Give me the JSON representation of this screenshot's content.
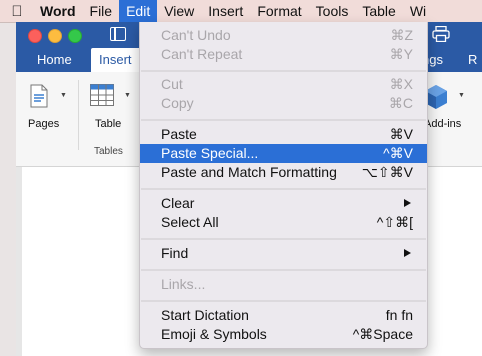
{
  "menubar": {
    "items": [
      {
        "label": "Word",
        "bold": true
      },
      {
        "label": "File"
      },
      {
        "label": "Edit",
        "active": true
      },
      {
        "label": "View"
      },
      {
        "label": "Insert"
      },
      {
        "label": "Format"
      },
      {
        "label": "Tools"
      },
      {
        "label": "Table"
      },
      {
        "label": "Wi"
      }
    ]
  },
  "window": {
    "tabs": {
      "home": "Home",
      "insert": "Insert",
      "ngs": "ngs",
      "r": "R"
    },
    "ribbon": {
      "pages_label": "Pages",
      "table_label": "Table",
      "tables_group_label": "Tables",
      "addins_label": "Add-ins"
    }
  },
  "edit_menu": {
    "items": [
      {
        "label": "Can't Undo",
        "shortcut": "⌘Z",
        "disabled": true
      },
      {
        "label": "Can't Repeat",
        "shortcut": "⌘Y",
        "disabled": true
      },
      {
        "label": "Cut",
        "shortcut": "⌘X",
        "disabled": true
      },
      {
        "label": "Copy",
        "shortcut": "⌘C",
        "disabled": true
      },
      {
        "label": "Paste",
        "shortcut": "⌘V"
      },
      {
        "label": "Paste Special...",
        "shortcut": "^⌘V",
        "highlighted": true
      },
      {
        "label": "Paste and Match Formatting",
        "shortcut": "⌥⇧⌘V"
      },
      {
        "label": "Clear",
        "submenu": true
      },
      {
        "label": "Select All",
        "shortcut": "^⇧⌘["
      },
      {
        "label": "Find",
        "submenu": true
      },
      {
        "label": "Links...",
        "disabled": true
      },
      {
        "label": "Start Dictation",
        "shortcut": "fn fn"
      },
      {
        "label": "Emoji & Symbols",
        "shortcut": "^⌘Space"
      }
    ]
  },
  "colors": {
    "menubar_bg": "#f1dcd9",
    "accent_blue": "#2b6fd6",
    "word_blue": "#2b5aa5",
    "menu_bg": "#ece9ee",
    "disabled_text": "#a9a6aa"
  },
  "icons": {
    "apple": "apple-logo-icon",
    "sidebar": "sidebar-toggle-icon",
    "print": "printer-icon",
    "pages": "pages-icon",
    "table": "table-grid-icon",
    "addins": "add-ins-cube-icon",
    "submenu": "chevron-right-icon"
  }
}
